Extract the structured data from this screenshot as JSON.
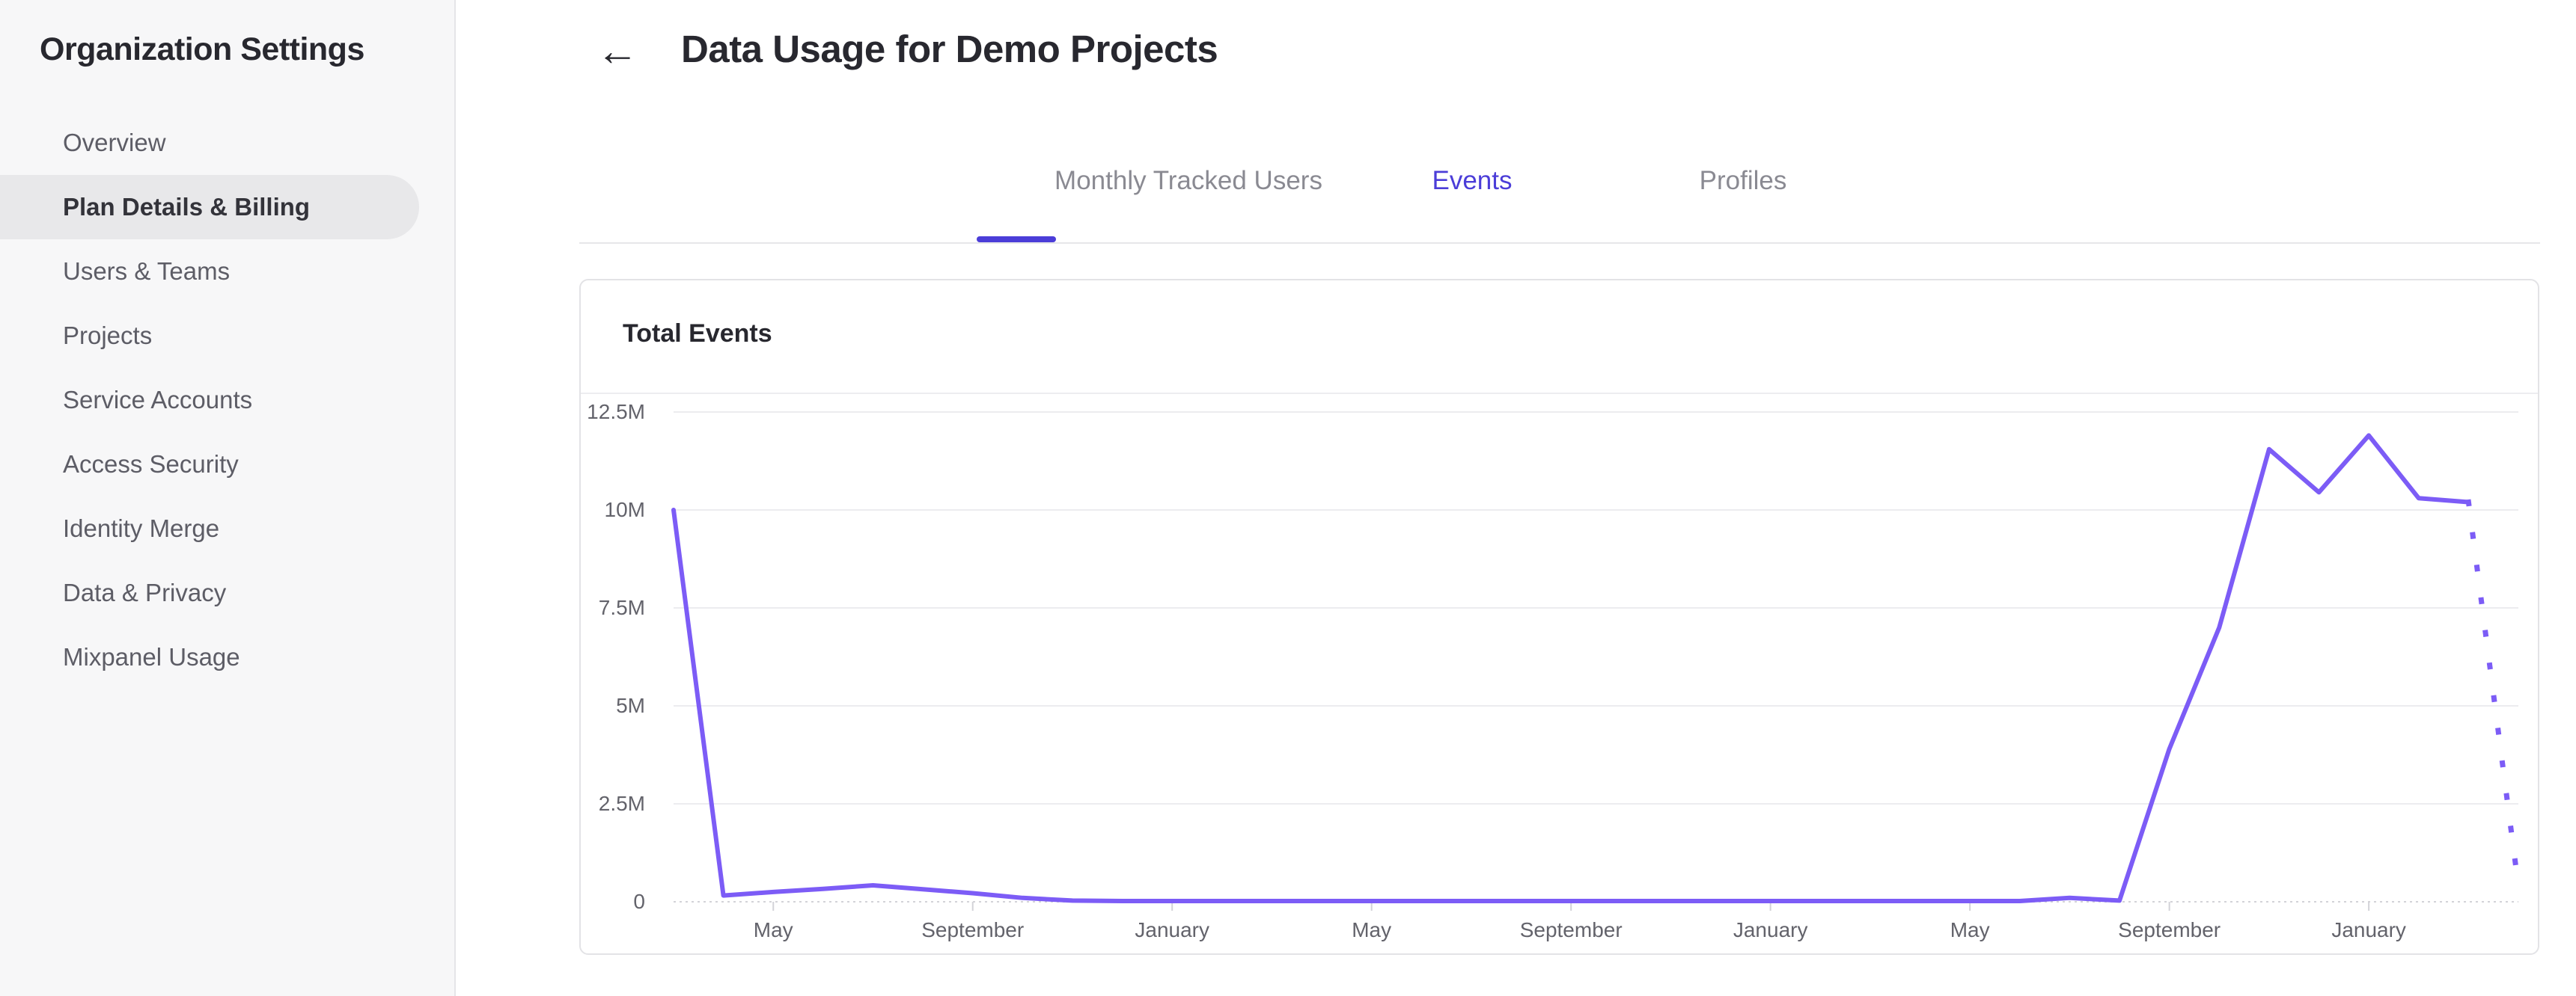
{
  "sidebar": {
    "title": "Organization Settings",
    "items": [
      {
        "label": "Overview",
        "active": false
      },
      {
        "label": "Plan Details & Billing",
        "active": true
      },
      {
        "label": "Users & Teams",
        "active": false
      },
      {
        "label": "Projects",
        "active": false
      },
      {
        "label": "Service Accounts",
        "active": false
      },
      {
        "label": "Access Security",
        "active": false
      },
      {
        "label": "Identity Merge",
        "active": false
      },
      {
        "label": "Data & Privacy",
        "active": false
      },
      {
        "label": "Mixpanel Usage",
        "active": false
      }
    ]
  },
  "header": {
    "back_icon": "←",
    "title": "Data Usage for Demo Projects"
  },
  "tabs": [
    {
      "label": "Monthly Tracked Users",
      "active": false,
      "center_x": 977
    },
    {
      "label": "Events",
      "active": true,
      "center_x": 1356
    },
    {
      "label": "Profiles",
      "active": false,
      "center_x": 1718
    }
  ],
  "card": {
    "title": "Total Events"
  },
  "colors": {
    "accent": "#4b3dd8",
    "chart_line": "#7c5cf6",
    "sidebar_bg": "#f7f7f8",
    "active_pill": "#e8e8ea",
    "grid": "#ececef"
  },
  "chart_data": {
    "type": "line",
    "title": "Total Events",
    "ylabel": "",
    "xlabel": "",
    "unit": "millions of events",
    "ylim": [
      0,
      12.5
    ],
    "grid": true,
    "legend": "none",
    "line_color": "#7c5cf6",
    "x": [
      "Mar",
      "Apr",
      "May",
      "Jun",
      "Jul",
      "Aug",
      "Sep",
      "Oct",
      "Nov",
      "Dec",
      "Jan",
      "Feb",
      "Mar",
      "Apr",
      "May",
      "Jun",
      "Jul",
      "Aug",
      "Sep",
      "Oct",
      "Nov",
      "Dec",
      "Jan",
      "Feb",
      "Mar",
      "Apr",
      "May",
      "Jun",
      "Jul",
      "Aug",
      "Sep",
      "Oct",
      "Nov",
      "Dec",
      "Jan",
      "Feb",
      "Mar",
      "Apr"
    ],
    "values_millions": [
      10,
      0.16,
      0.25,
      0.33,
      0.42,
      0.32,
      0.22,
      0.1,
      0.03,
      0.02,
      0.02,
      0.02,
      0.02,
      0.02,
      0.02,
      0.02,
      0.02,
      0.02,
      0.02,
      0.02,
      0.02,
      0.02,
      0.02,
      0.02,
      0.02,
      0.02,
      0.02,
      0.02,
      0.1,
      0.03,
      3.9,
      7.0,
      11.55,
      10.45,
      11.9,
      10.3,
      10.2,
      0.4
    ],
    "dashed_from_index": 36,
    "x_tick_labels": [
      {
        "index": 2,
        "label": "May"
      },
      {
        "index": 6,
        "label": "September"
      },
      {
        "index": 10,
        "label": "January"
      },
      {
        "index": 14,
        "label": "May"
      },
      {
        "index": 18,
        "label": "September"
      },
      {
        "index": 22,
        "label": "January"
      },
      {
        "index": 26,
        "label": "May"
      },
      {
        "index": 30,
        "label": "September"
      },
      {
        "index": 34,
        "label": "January"
      }
    ],
    "y_ticks": [
      {
        "value": 0,
        "label": "0"
      },
      {
        "value": 2.5,
        "label": "2.5M"
      },
      {
        "value": 5,
        "label": "5M"
      },
      {
        "value": 7.5,
        "label": "7.5M"
      },
      {
        "value": 10,
        "label": "10M"
      },
      {
        "value": 12.5,
        "label": "12.5M"
      }
    ]
  }
}
